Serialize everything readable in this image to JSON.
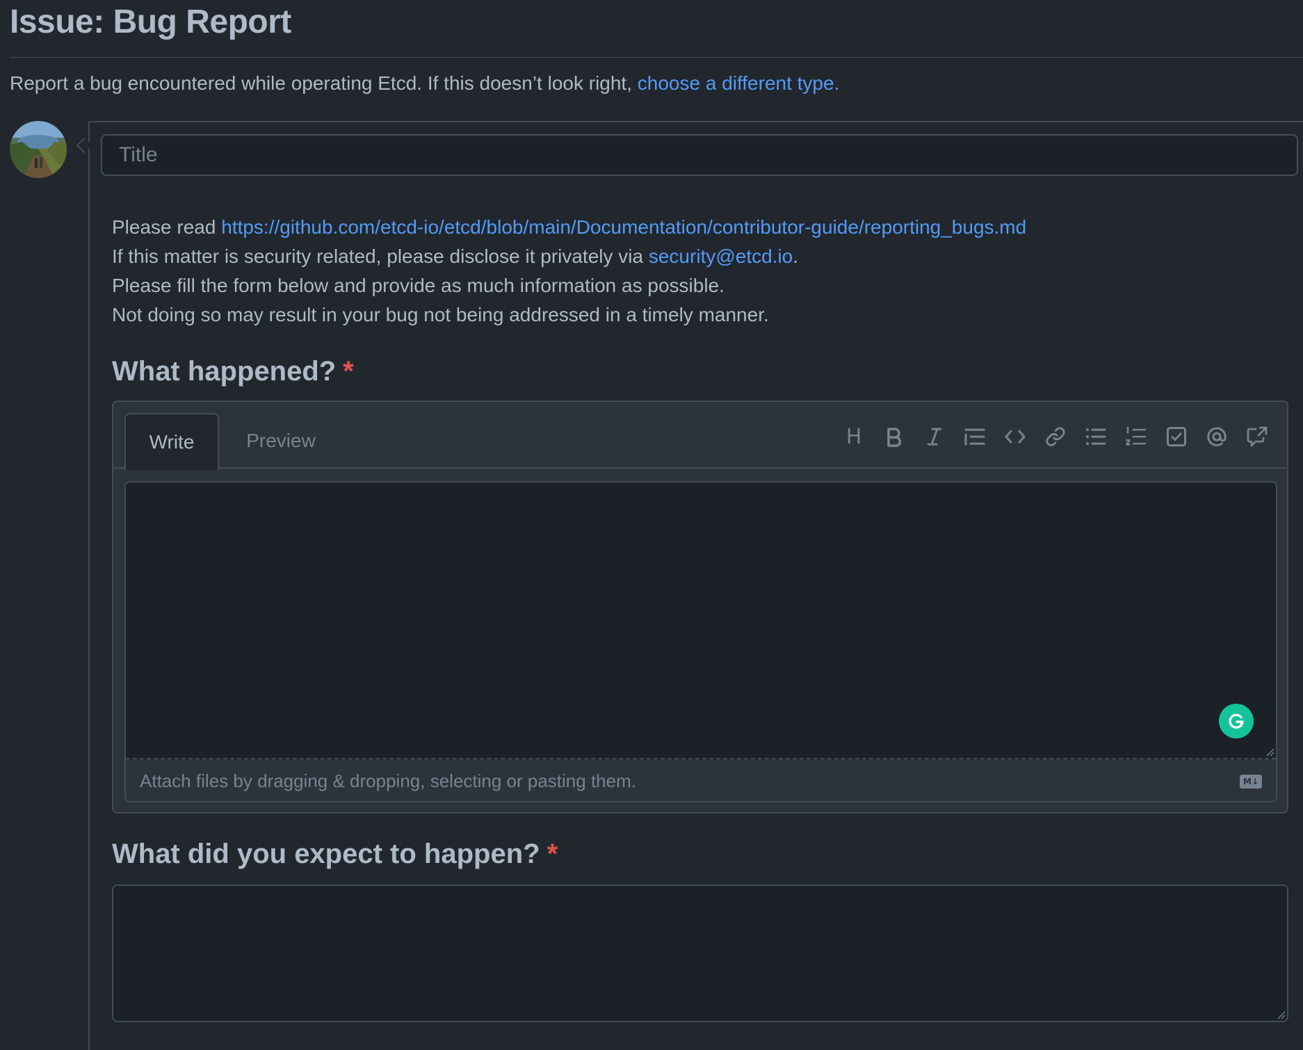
{
  "page": {
    "title": "Issue: Bug Report",
    "subtitle_text": "Report a bug encountered while operating Etcd. If this doesn’t look right, ",
    "subtitle_link": "choose a different type."
  },
  "title_input": {
    "placeholder": "Title",
    "value": ""
  },
  "intro": {
    "line1_prefix": "Please read ",
    "line1_link": "https://github.com/etcd-io/etcd/blob/main/Documentation/contributor-guide/reporting_bugs.md",
    "line2_prefix": "If this matter is security related, please disclose it privately via ",
    "line2_link": "security@etcd.io",
    "line2_suffix": ".",
    "line3": "Please fill the form below and provide as much information as possible.",
    "line4": "Not doing so may result in your bug not being addressed in a timely manner."
  },
  "fields": {
    "what_happened": {
      "label": "What happened?",
      "required_mark": "*",
      "tabs": {
        "write": "Write",
        "preview": "Preview"
      },
      "attach_hint": "Attach files by dragging & dropping, selecting or pasting them.",
      "markdown_badge": "M↓",
      "value": ""
    },
    "expected": {
      "label": "What did you expect to happen?",
      "required_mark": "*",
      "value": ""
    }
  },
  "toolbar": [
    "heading-icon",
    "bold-icon",
    "italic-icon",
    "quote-icon",
    "code-icon",
    "link-icon",
    "bulleted-list-icon",
    "numbered-list-icon",
    "task-list-icon",
    "mention-icon",
    "reference-icon"
  ],
  "colors": {
    "background": "#22272e",
    "input_background": "#1c2128",
    "border": "#444c56",
    "text": "#adbac7",
    "muted": "#768390",
    "link": "#539bf5",
    "required": "#e5534b",
    "grammarly": "#15c39a"
  }
}
